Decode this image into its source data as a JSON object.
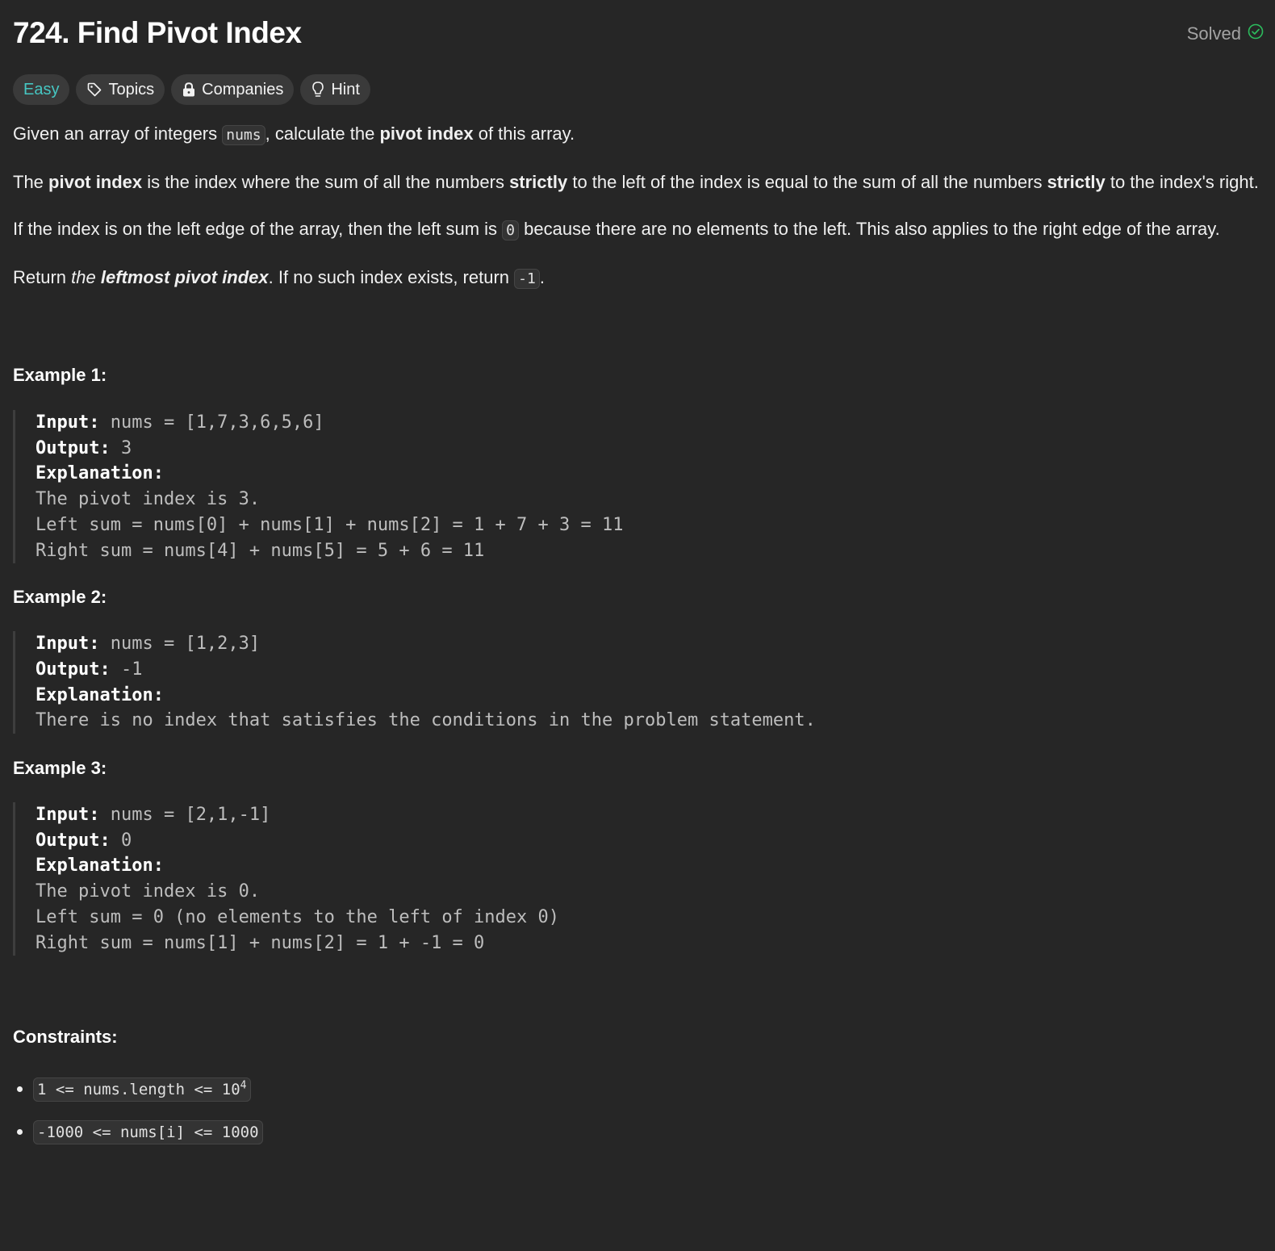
{
  "problem": {
    "title": "724. Find Pivot Index",
    "status": "Solved"
  },
  "tags": [
    {
      "label": "Easy",
      "icon": ""
    },
    {
      "label": "Topics",
      "icon": "tag-icon"
    },
    {
      "label": "Companies",
      "icon": "lock-icon"
    },
    {
      "label": "Hint",
      "icon": "lightbulb-icon"
    }
  ],
  "description": {
    "p1": {
      "t1": "Given an array of integers ",
      "code": "nums",
      "t2": ", calculate the ",
      "bold": "pivot index",
      "t3": " of this array."
    },
    "p2": {
      "t1": "The ",
      "b1": "pivot index",
      "t2": " is the index where the sum of all the numbers ",
      "b2": "strictly",
      "t3": " to the left of the index is equal to the sum of all the numbers ",
      "b3": "strictly",
      "t4": " to the index's right."
    },
    "p3": {
      "t1": "If the index is on the left edge of the array, then the left sum is ",
      "code": "0",
      "t2": " because there are no elements to the left. This also applies to the right edge of the array."
    },
    "p4": {
      "t1": "Return ",
      "i1": "the ",
      "bi": "leftmost pivot index",
      "t2": ". If no such index exists, return ",
      "code": "-1",
      "t3": "."
    }
  },
  "examples": [
    {
      "title": "Example 1:",
      "input_label": "Input:",
      "input": " nums = [1,7,3,6,5,6]",
      "output_label": "Output:",
      "output": " 3",
      "explanation_label": "Explanation:",
      "lines": [
        "The pivot index is 3.",
        "Left sum = nums[0] + nums[1] + nums[2] = 1 + 7 + 3 = 11",
        "Right sum = nums[4] + nums[5] = 5 + 6 = 11"
      ]
    },
    {
      "title": "Example 2:",
      "input_label": "Input:",
      "input": " nums = [1,2,3]",
      "output_label": "Output:",
      "output": " -1",
      "explanation_label": "Explanation:",
      "lines": [
        "There is no index that satisfies the conditions in the problem statement."
      ]
    },
    {
      "title": "Example 3:",
      "input_label": "Input:",
      "input": " nums = [2,1,-1]",
      "output_label": "Output:",
      "output": " 0",
      "explanation_label": "Explanation:",
      "lines": [
        "The pivot index is 0.",
        "Left sum = 0 (no elements to the left of index 0)",
        "Right sum = nums[1] + nums[2] = 1 + -1 = 0"
      ]
    }
  ],
  "constraints": {
    "title": "Constraints:",
    "c1": {
      "text": "1 <= nums.length <= 10",
      "sup": "4"
    },
    "c2": {
      "text": "-1000 <= nums[i] <= 1000"
    }
  },
  "colors": {
    "background": "#262626",
    "easy": "#46c6c2",
    "solved_check": "#2cbb5d"
  }
}
